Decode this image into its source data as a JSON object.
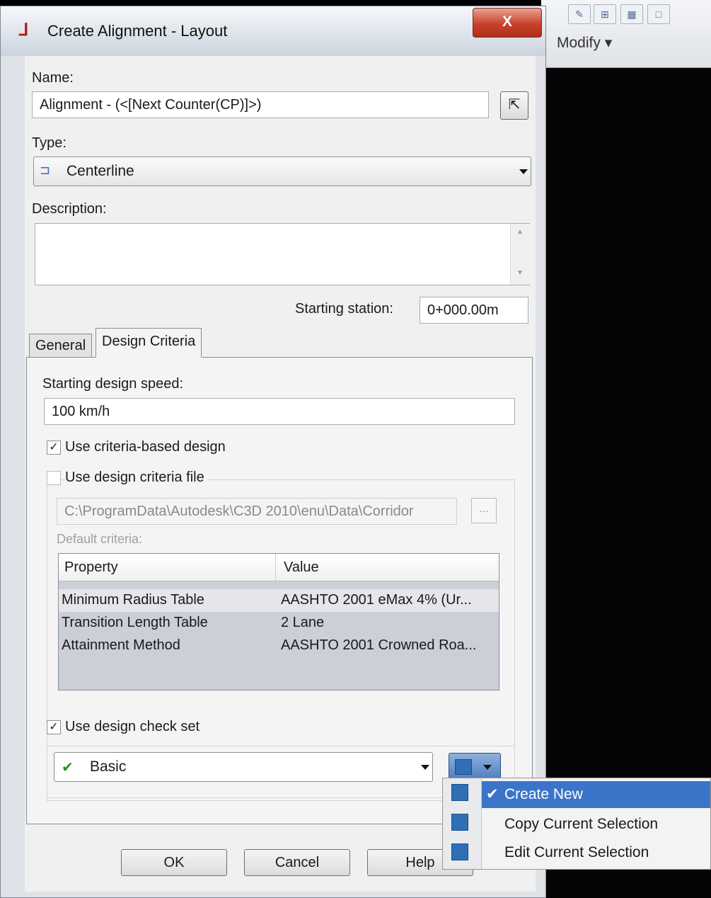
{
  "window": {
    "title": "Create Alignment - Layout",
    "close_glyph": "X"
  },
  "background_app": {
    "panel_label": "Modify"
  },
  "name": {
    "label": "Name:",
    "value": "Alignment - (<[Next Counter(CP)]>)"
  },
  "type": {
    "label": "Type:",
    "value": "Centerline"
  },
  "description": {
    "label": "Description:",
    "value": ""
  },
  "starting_station": {
    "label": "Starting station:",
    "value": "0+000.00m"
  },
  "tabs": [
    {
      "label": "General",
      "active": false
    },
    {
      "label": "Design Criteria",
      "active": true
    }
  ],
  "design": {
    "speed_label": "Starting design speed:",
    "speed_value": "100 km/h",
    "use_criteria_label": "Use criteria-based design",
    "use_criteria_checked": true,
    "use_file_label": "Use design criteria file",
    "use_file_checked": false,
    "file_path": "C:\\ProgramData\\Autodesk\\C3D 2010\\enu\\Data\\Corridor",
    "browse_glyph": "...",
    "default_criteria_label": "Default criteria:",
    "grid": {
      "headers": [
        "Property",
        "Value"
      ],
      "rows": [
        {
          "property": "Minimum Radius Table",
          "value": "AASHTO 2001 eMax 4% (Ur..."
        },
        {
          "property": "Transition Length Table",
          "value": "2 Lane"
        },
        {
          "property": "Attainment Method",
          "value": "AASHTO 2001 Crowned Roa..."
        }
      ]
    },
    "use_check_set_label": "Use design check set",
    "use_check_set_checked": true,
    "check_set_value": "Basic"
  },
  "buttons": {
    "ok": "OK",
    "cancel": "Cancel",
    "help": "Help"
  },
  "menu": {
    "items": [
      {
        "label": "Create New",
        "checked": true,
        "highlighted": true,
        "icon": "create-new-icon"
      },
      {
        "label": "Copy Current Selection",
        "checked": false,
        "highlighted": false,
        "icon": "copy-selection-icon"
      },
      {
        "label": "Edit Current Selection",
        "checked": false,
        "highlighted": false,
        "icon": "edit-selection-icon"
      }
    ]
  },
  "colors": {
    "menu_highlight": "#3b75c9",
    "close_button": "#c7412c"
  }
}
